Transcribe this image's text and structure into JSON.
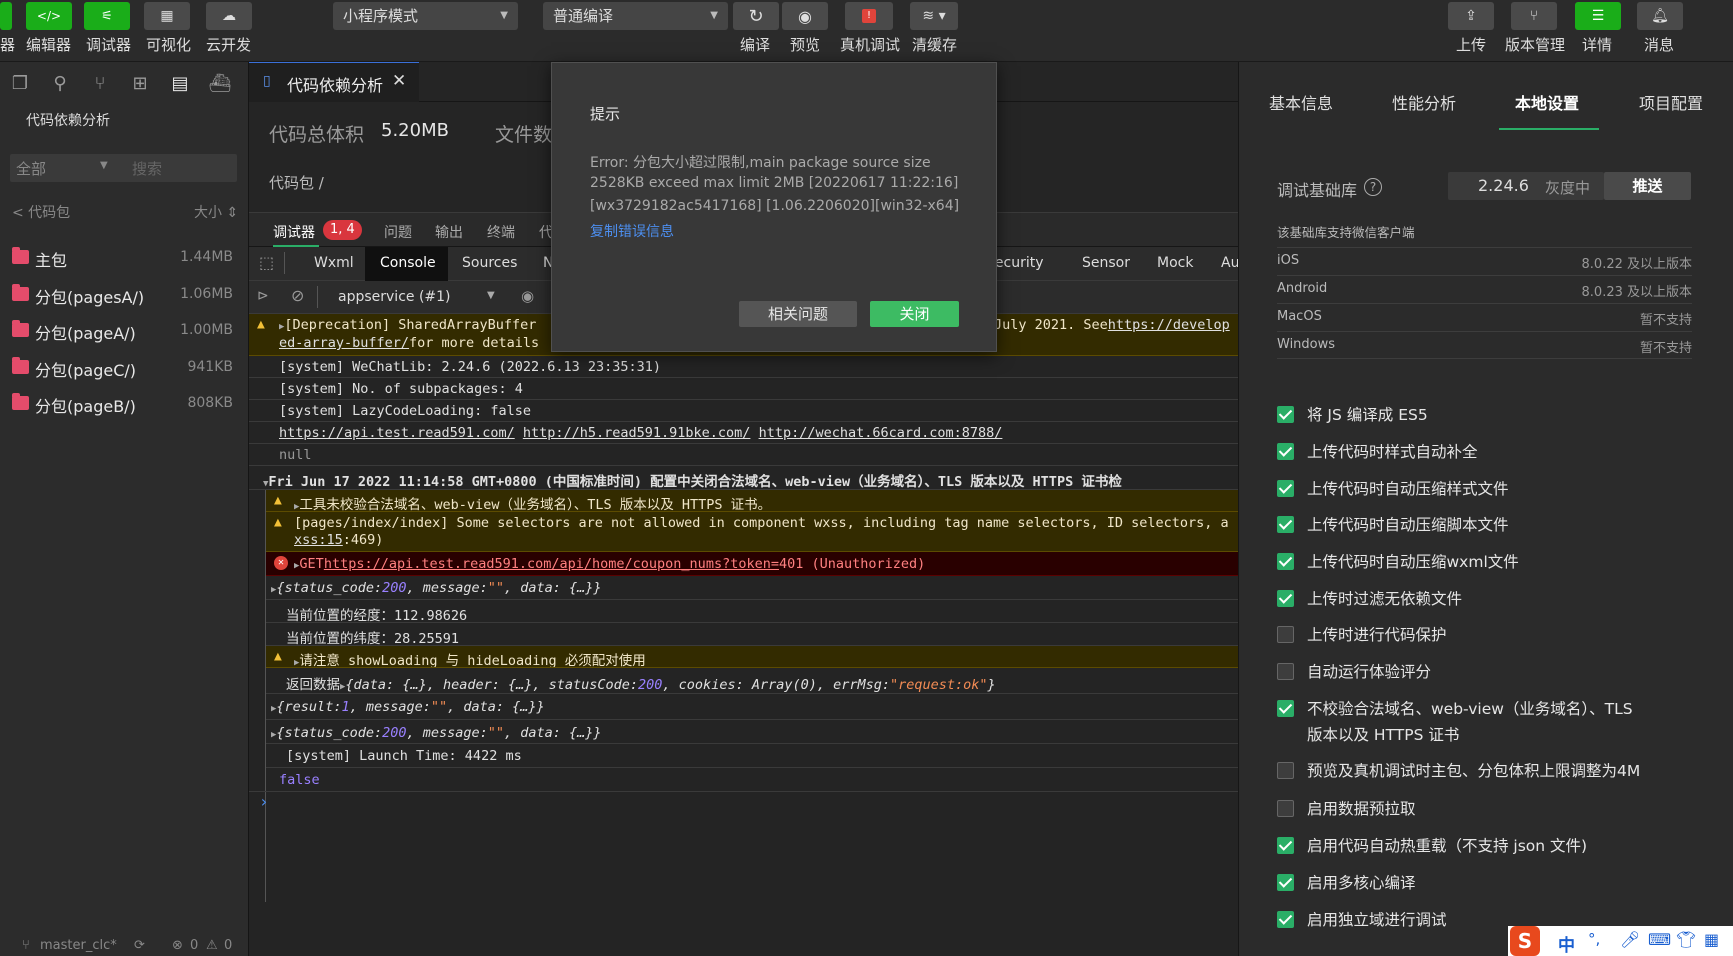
{
  "toolbar": {
    "left_buttons": [
      {
        "label": "器",
        "icon": "simulator-icon"
      },
      {
        "label": "编辑器",
        "icon": "code-icon"
      },
      {
        "label": "调试器",
        "icon": "debug-icon"
      },
      {
        "label": "可视化",
        "icon": "visual-icon"
      },
      {
        "label": "云开发",
        "icon": "cloud-icon"
      }
    ],
    "mode_select": "小程序模式",
    "compile_select": "普通编译",
    "mid_buttons": [
      {
        "label": "编译",
        "icon": "refresh-icon"
      },
      {
        "label": "预览",
        "icon": "eye-icon"
      },
      {
        "label": "真机调试",
        "icon": "phone-debug-icon"
      },
      {
        "label": "清缓存",
        "icon": "layers-icon"
      }
    ],
    "right_buttons": [
      {
        "label": "上传",
        "icon": "upload-icon"
      },
      {
        "label": "版本管理",
        "icon": "branch-icon"
      },
      {
        "label": "详情",
        "icon": "menu-icon"
      },
      {
        "label": "消息",
        "icon": "bell-icon"
      }
    ]
  },
  "sidebar": {
    "title": "代码依赖分析",
    "filter_select": "全部",
    "search_placeholder": "搜索",
    "back_label": "< 代码包",
    "sort_label": "大小 ⇕",
    "packages": [
      {
        "name": "主包",
        "size": "1.44MB"
      },
      {
        "name": "分包(pagesA/)",
        "size": "1.06MB"
      },
      {
        "name": "分包(pageA/)",
        "size": "1.00MB"
      },
      {
        "name": "分包(pageC/)",
        "size": "941KB"
      },
      {
        "name": "分包(pageB/)",
        "size": "808KB"
      }
    ],
    "status": {
      "branch": "master_clc*",
      "errors": "0",
      "warnings": "0"
    }
  },
  "editor": {
    "tab_label": "代码依赖分析",
    "total_label": "代码总体积",
    "total_value": "5.20MB",
    "files_label": "文件数",
    "breadcrumb": "代码包 /"
  },
  "debugger": {
    "tabs": [
      "调试器",
      "问题",
      "输出",
      "终端",
      "代"
    ],
    "badge": "1, 4",
    "dev_tabs": [
      "Wxml",
      "Console",
      "Sources",
      "N",
      "Security",
      "Sensor",
      "Mock",
      "Au"
    ],
    "context_select": "appservice (#1)"
  },
  "console": {
    "deprecation_prefix": "[Deprecation] SharedArrayBuffer",
    "deprecation_mid": "July 2021. See ",
    "deprecation_link": "https://develop",
    "deprecation_link2": "ed-array-buffer/",
    "deprecation_tail": " for more details",
    "wechatlib": "[system] WeChatLib: 2.24.6 (2022.6.13 23:35:31)",
    "subpackages": "[system] No. of subpackages: 4",
    "lazy": "[system] LazyCodeLoading: false",
    "links": [
      "https://api.test.read591.com/",
      "http://h5.read591.91bke.com/",
      "http://wechat.66card.com:8788/"
    ],
    "null_line": "null",
    "group_header": "Fri Jun 17 2022 11:14:58 GMT+0800 (中国标准时间) 配置中关闭合法域名、web-view（业务域名）、TLS 版本以及 HTTPS 证书检",
    "warn1": "工具未校验合法域名、web-view（业务域名）、TLS 版本以及 HTTPS 证书。",
    "warn2": "[pages/index/index] Some selectors are not allowed in component wxss, including tag name selectors, ID selectors, a",
    "warn2_link": "xss:15",
    "warn2_tail": ":469)",
    "err_method": "GET ",
    "err_url": "https://api.test.read591.com/api/home/coupon_nums?token=",
    "err_status": " 401 (Unauthorized)",
    "obj1_a": "{status_code: ",
    "obj1_num": "200",
    "obj1_b": ", message: ",
    "obj1_str": "\"\"",
    "obj1_c": ", data: {…}}",
    "longitude": "当前位置的经度：112.98626",
    "latitude": "当前位置的纬度：28.25591",
    "warn3": "请注意 showLoading 与 hideLoading 必须配对使用",
    "ret_label": "返回数据 ",
    "ret_a": "{data: {…}, header: {…}, statusCode: ",
    "ret_num": "200",
    "ret_b": ", cookies: Array(0), errMsg: ",
    "ret_str": "\"request:ok\"",
    "ret_c": "}",
    "obj2_a": "{result: ",
    "obj2_num": "1",
    "obj2_b": ", message: ",
    "obj2_str": "\"\"",
    "obj2_c": ", data: {…}}",
    "obj3_a": "{status_code: ",
    "obj3_num": "200",
    "obj3_b": ", message: ",
    "obj3_str": "\"\"",
    "obj3_c": ", data: {…}}",
    "launch": "[system] Launch Time: 4422 ms",
    "false_line": "false",
    "prompt": "›"
  },
  "dialog": {
    "title": "提示",
    "line1": "Error: 分包大小超过限制,main package source size",
    "line2": "2528KB exceed max limit 2MB [20220617 11:22:16]",
    "line3": "[wx3729182ac5417168] [1.06.2206020][win32-x64]",
    "copy_link": "复制错误信息",
    "related_button": "相关问题",
    "close_button": "关闭"
  },
  "right_panel": {
    "tabs": [
      "基本信息",
      "性能分析",
      "本地设置",
      "项目配置"
    ],
    "active_tab": "本地设置",
    "base_lib_label": "调试基础库",
    "base_lib_version": "2.24.6",
    "base_lib_status": "灰度中",
    "push_button": "推送",
    "support_title": "该基础库支持微信客户端",
    "platforms": [
      {
        "name": "iOS",
        "value": "8.0.22 及以上版本"
      },
      {
        "name": "Android",
        "value": "8.0.23 及以上版本"
      },
      {
        "name": "MacOS",
        "value": "暂不支持"
      },
      {
        "name": "Windows",
        "value": "暂不支持"
      }
    ],
    "options": [
      {
        "label": "将 JS 编译成 ES5",
        "checked": true
      },
      {
        "label": "上传代码时样式自动补全",
        "checked": true
      },
      {
        "label": "上传代码时自动压缩样式文件",
        "checked": true
      },
      {
        "label": "上传代码时自动压缩脚本文件",
        "checked": true
      },
      {
        "label": "上传代码时自动压缩wxml文件",
        "checked": true
      },
      {
        "label": "上传时过滤无依赖文件",
        "checked": true
      },
      {
        "label": "上传时进行代码保护",
        "checked": false
      },
      {
        "label": "自动运行体验评分",
        "checked": false
      },
      {
        "label": "不校验合法域名、web-view（业务域名）、TLS",
        "label2": "版本以及 HTTPS 证书",
        "checked": true
      },
      {
        "label": "预览及真机调试时主包、分包体积上限调整为4M",
        "checked": false
      },
      {
        "label": "启用数据预拉取",
        "checked": false
      },
      {
        "label": "启用代码自动热重载（不支持 json 文件)",
        "checked": true
      },
      {
        "label": "启用多核心编译",
        "checked": true
      },
      {
        "label": "启用独立域进行调试",
        "checked": true
      }
    ]
  },
  "ime": {
    "lang": "中",
    "punct": "°,"
  }
}
